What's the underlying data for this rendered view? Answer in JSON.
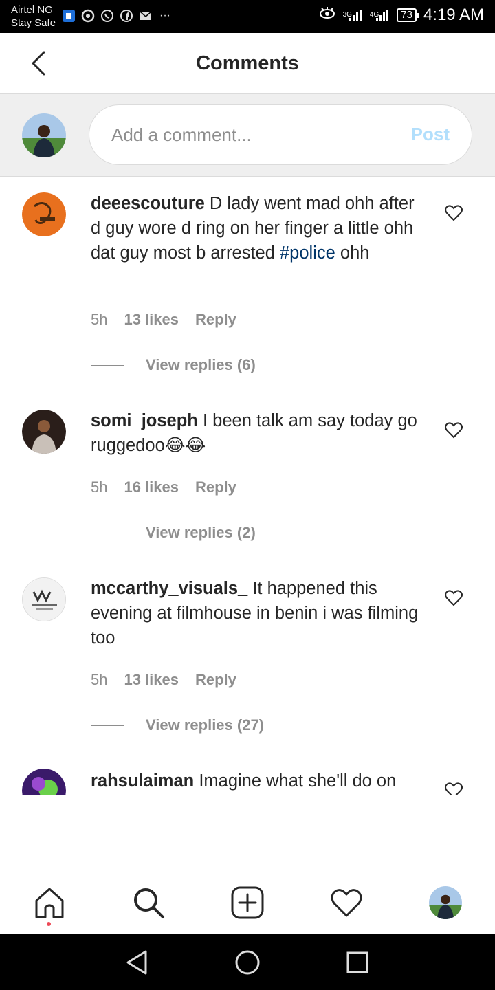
{
  "status_bar": {
    "carrier": "Airtel NG",
    "carrier_sub": "Stay Safe",
    "network_3g": "3G",
    "network_4g": "4G",
    "battery": "73",
    "time": "4:19 AM"
  },
  "header": {
    "title": "Comments"
  },
  "composer": {
    "placeholder": "Add a comment...",
    "post_label": "Post"
  },
  "comments": [
    {
      "username": "deeescouture",
      "text": "D lady went mad ohh after d guy wore d ring on her finger a little ohh dat guy most b arrested ",
      "hashtag": "#police",
      "text_after": " ohh",
      "time": "5h",
      "likes": "13 likes",
      "reply": "Reply",
      "view_replies": "View replies (6)"
    },
    {
      "username": "somi_joseph",
      "text": "I been talk am say today go ruggedoo😂😂",
      "time": "5h",
      "likes": "16 likes",
      "reply": "Reply",
      "view_replies": "View replies (2)"
    },
    {
      "username": "mccarthy_visuals_",
      "text": "It happened this evening at filmhouse in benin i was filming too",
      "time": "5h",
      "likes": "13 likes",
      "reply": "Reply",
      "view_replies": "View replies (27)"
    },
    {
      "username": "rahsulaiman",
      "text": "Imagine what she'll do on"
    }
  ],
  "colors": {
    "accent_link": "#003569",
    "post_disabled": "#b2dffc",
    "secondary_text": "#8e8e8e",
    "notification_dot": "#ed4956"
  },
  "nav": {
    "items": [
      "home-icon",
      "search-icon",
      "new-post-icon",
      "activity-heart-icon",
      "profile-avatar"
    ]
  }
}
